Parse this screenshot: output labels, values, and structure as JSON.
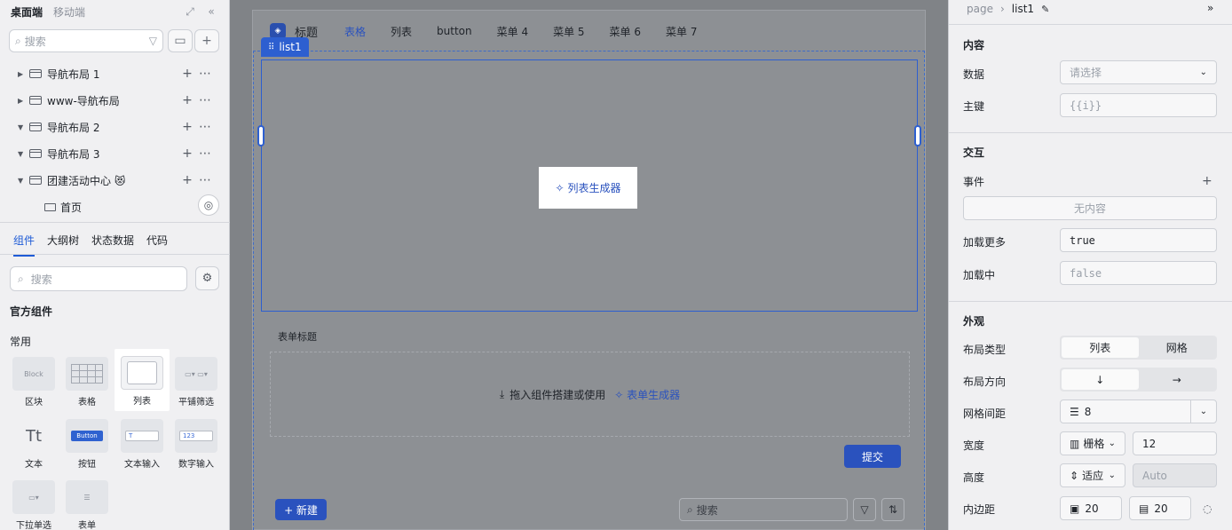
{
  "left": {
    "modes": [
      "桌面端",
      "移动端"
    ],
    "search_placeholder": "搜索",
    "tree": [
      {
        "label": "导航布局 1",
        "expanded": false
      },
      {
        "label": "www-导航布局",
        "expanded": false
      },
      {
        "label": "导航布局 2",
        "expanded": true
      },
      {
        "label": "导航布局 3",
        "expanded": true
      },
      {
        "label": "团建活动中心 😻",
        "expanded": true
      }
    ],
    "child_page": "首页",
    "tabs": [
      "组件",
      "大纲树",
      "状态数据",
      "代码"
    ],
    "component_search_placeholder": "搜索",
    "official_title": "官方组件",
    "common_title": "常用",
    "components": [
      {
        "label": "区块",
        "thumb": "Block"
      },
      {
        "label": "表格",
        "thumb": ""
      },
      {
        "label": "列表",
        "thumb": ""
      },
      {
        "label": "平铺筛选",
        "thumb": ""
      },
      {
        "label": "文本",
        "thumb": "Tt"
      },
      {
        "label": "按钮",
        "thumb": "Button"
      },
      {
        "label": "文本输入",
        "thumb": "T"
      },
      {
        "label": "数字输入",
        "thumb": "123"
      },
      {
        "label": "下拉单选",
        "thumb": ""
      },
      {
        "label": "表单",
        "thumb": ""
      }
    ]
  },
  "canvas": {
    "brand": "标题",
    "menus": [
      "表格",
      "列表",
      "button",
      "菜单 4",
      "菜单 5",
      "菜单 6",
      "菜单 7"
    ],
    "list_tag": "list1",
    "list_generator": "列表生成器",
    "form_title": "表单标题",
    "drop_hint": "拖入组件搭建或使用",
    "form_generator": "表单生成器",
    "submit": "提交",
    "new_button": "+ 新建",
    "search_placeholder": "搜索"
  },
  "right": {
    "breadcrumb": [
      "page",
      "list1"
    ],
    "sections": {
      "content": "内容",
      "interaction": "交互",
      "appearance": "外观"
    },
    "data_label": "数据",
    "data_placeholder": "请选择",
    "key_label": "主键",
    "key_value": "{{i}}",
    "event_label": "事件",
    "event_empty": "无内容",
    "load_more_label": "加载更多",
    "load_more_value": "true",
    "loading_label": "加载中",
    "loading_value": "false",
    "layout_type_label": "布局类型",
    "layout_type_options": [
      "列表",
      "网格"
    ],
    "direction_label": "布局方向",
    "direction_options": [
      "↓",
      "→"
    ],
    "gap_label": "网格间距",
    "gap_value": "8",
    "width_label": "宽度",
    "width_mode": "栅格",
    "width_value": "12",
    "height_label": "高度",
    "height_mode": "适应",
    "height_placeholder": "Auto",
    "padding_label": "内边距",
    "padding_values": [
      "20",
      "20"
    ]
  },
  "colors": {
    "accent": "#2a52be",
    "selection": "#2d5fd0"
  }
}
